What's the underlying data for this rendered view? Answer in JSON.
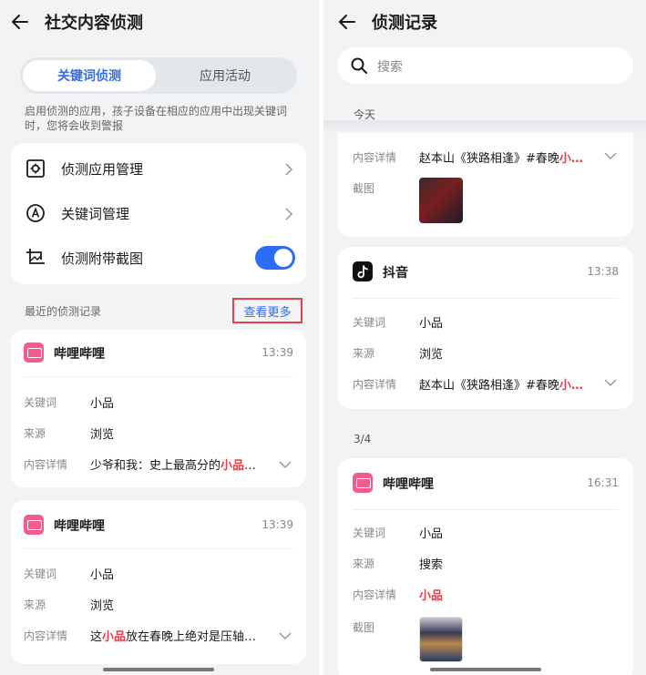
{
  "left": {
    "header": {
      "title": "社交内容侦测"
    },
    "tabs": [
      {
        "label": "关键词侦测",
        "active": true
      },
      {
        "label": "应用活动",
        "active": false
      }
    ],
    "hint": "启用侦测的应用，孩子设备在相应的应用中出现关键词时，您将会收到警报",
    "settings": [
      {
        "label": "侦测应用管理",
        "icon": "app-manage-icon",
        "control": "chevron"
      },
      {
        "label": "关键词管理",
        "icon": "keyword-icon",
        "control": "chevron"
      },
      {
        "label": "侦测附带截图",
        "icon": "screenshot-icon",
        "control": "toggle",
        "enabled": true
      }
    ],
    "recent_label": "最近的侦测记录",
    "more_label": "查看更多",
    "records": [
      {
        "app": "哔哩哔哩",
        "time": "13:39",
        "keyword_label": "关键词",
        "keyword": "小品",
        "source_label": "来源",
        "source": "浏览",
        "detail_label": "内容详情",
        "detail_pre": "少爷和我：史上最高分的",
        "detail_hl": "小品",
        "detail_post": "…"
      },
      {
        "app": "哔哩哔哩",
        "time": "13:39",
        "keyword_label": "关键词",
        "keyword": "小品",
        "source_label": "来源",
        "source": "浏览",
        "detail_label": "内容详情",
        "detail_pre": "这",
        "detail_hl": "小品",
        "detail_post": "放在春晚上绝对是压轴…"
      }
    ]
  },
  "right": {
    "header": {
      "title": "侦测记录"
    },
    "search": {
      "placeholder": "搜索"
    },
    "groups": {
      "today": "今天",
      "date": "3/4"
    },
    "card_partial": {
      "detail_label": "内容详情",
      "detail_pre": "赵本山《狭路相逢》#春晚",
      "detail_hl": "小…",
      "screenshot_label": "截图"
    },
    "card_douyin": {
      "app": "抖音",
      "time": "13:38",
      "keyword_label": "关键词",
      "keyword": "小品",
      "source_label": "来源",
      "source": "浏览",
      "detail_label": "内容详情",
      "detail_pre": "赵本山《狭路相逢》#春晚",
      "detail_hl": "小…"
    },
    "card_bili": {
      "app": "哔哩哔哩",
      "time": "16:31",
      "keyword_label": "关键词",
      "keyword": "小品",
      "source_label": "来源",
      "source": "搜索",
      "detail_label": "内容详情",
      "detail_hl": "小品",
      "screenshot_label": "截图"
    }
  },
  "colors": {
    "accent": "#2d6cf6",
    "highlight": "#e8404a",
    "bilibili": "#f25d8e",
    "douyin": "#111111",
    "background": "#f1f3f5"
  }
}
